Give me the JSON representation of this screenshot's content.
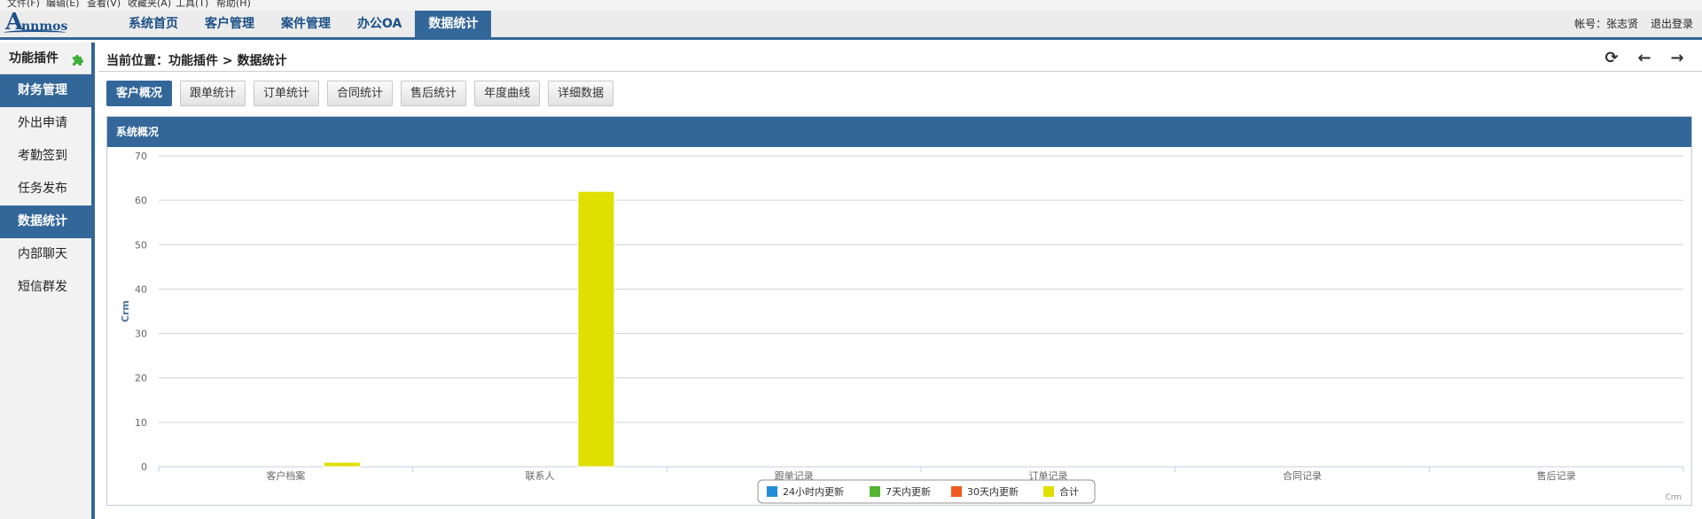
{
  "menu": [
    "文件(F)",
    "编辑(E)",
    "查看(V)",
    "收藏夹(A)",
    "工具(T)",
    "帮助(H)"
  ],
  "logo": {
    "big": "A",
    "small": "nnmos"
  },
  "nav": [
    {
      "label": "系统首页"
    },
    {
      "label": "客户管理"
    },
    {
      "label": "案件管理"
    },
    {
      "label": "办公OA"
    },
    {
      "label": "数据统计",
      "active": true
    }
  ],
  "user": {
    "account": "帐号：张志贤",
    "logout": "退出登录"
  },
  "sidebar": {
    "title": "功能插件",
    "items": [
      {
        "label": "财务管理",
        "active": true
      },
      {
        "label": "外出申请"
      },
      {
        "label": "考勤签到"
      },
      {
        "label": "任务发布"
      },
      {
        "label": "数据统计",
        "active": true
      },
      {
        "label": "内部聊天"
      },
      {
        "label": "短信群发"
      }
    ]
  },
  "breadcrumb": "当前位置：功能插件 > 数据统计",
  "tools": {
    "refresh": "⟳",
    "back": "←",
    "forward": "→"
  },
  "tabs": [
    {
      "label": "客户概况",
      "active": true
    },
    {
      "label": "跟单统计"
    },
    {
      "label": "订单统计"
    },
    {
      "label": "合同统计"
    },
    {
      "label": "售后统计"
    },
    {
      "label": "年度曲线"
    },
    {
      "label": "详细数据"
    }
  ],
  "panel": {
    "title": "系统概况"
  },
  "chart_data": {
    "type": "bar",
    "categories": [
      "客户档案",
      "联系人",
      "跟单记录",
      "订单记录",
      "合同记录",
      "售后记录"
    ],
    "series": [
      {
        "name": "24小时内更新",
        "color": "#1f8dd6",
        "values": [
          0,
          0,
          0,
          0,
          0,
          0
        ]
      },
      {
        "name": "7天内更新",
        "color": "#55b432",
        "values": [
          0,
          0,
          0,
          0,
          0,
          0
        ]
      },
      {
        "name": "30天内更新",
        "color": "#f05a24",
        "values": [
          0,
          0,
          0,
          0,
          0,
          0
        ]
      },
      {
        "name": "合计",
        "color": "#dfdf00",
        "values": [
          1,
          62,
          0,
          0,
          0,
          0
        ]
      }
    ],
    "ylabel": "Crm",
    "ylim": [
      0,
      70
    ],
    "yticks": [
      0,
      10,
      20,
      30,
      40,
      50,
      60,
      70
    ],
    "grid": true,
    "legend": "bottom-center",
    "credit": "Crm"
  }
}
